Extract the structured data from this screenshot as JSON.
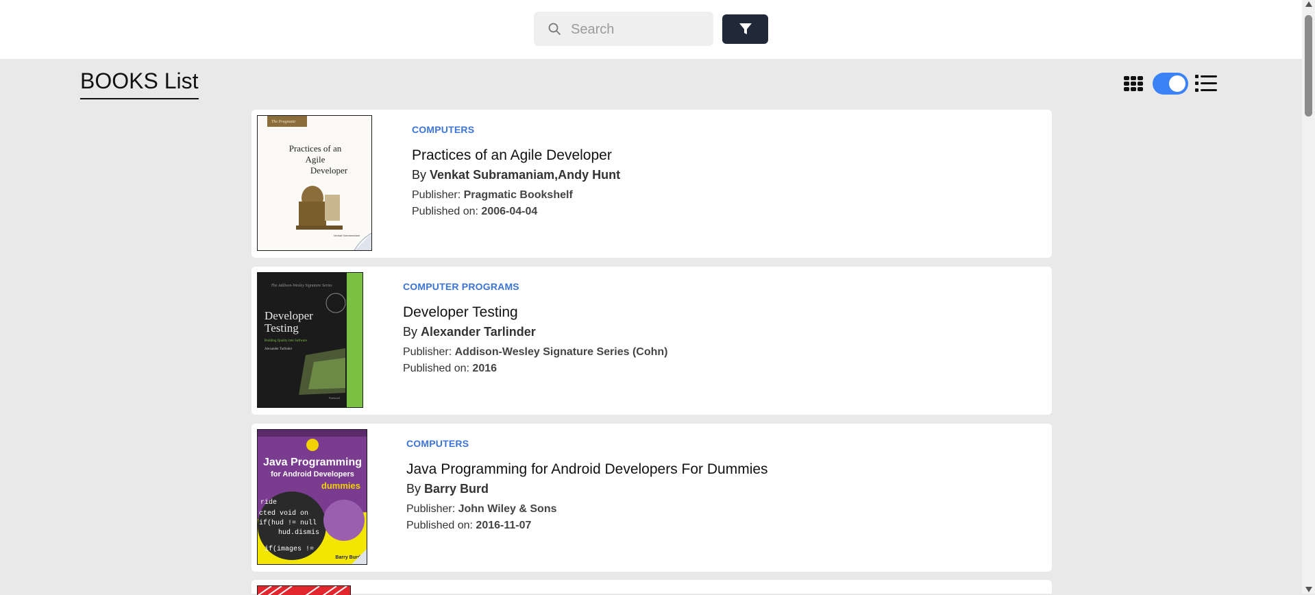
{
  "search": {
    "placeholder": "Search",
    "value": ""
  },
  "filter_button": {
    "icon": "funnel-icon"
  },
  "page": {
    "title": "BOOKS List"
  },
  "view_toggle": {
    "grid_icon": "grid-icon",
    "list_icon": "list-icon",
    "mode": "list",
    "accent": "#3b82f6"
  },
  "books": [
    {
      "category": "COMPUTERS",
      "title": "Practices of an Agile Developer",
      "by_label": "By",
      "authors": "Venkat Subramaniam,Andy Hunt",
      "publisher_label": "Publisher:",
      "publisher": "Pragmatic Bookshelf",
      "published_label": "Published on:",
      "published": "2006-04-04",
      "cover": {
        "line1": "Practices of an",
        "line2": "Agile",
        "line3": "Developer",
        "small": "Venkat Subramaniam"
      }
    },
    {
      "category": "COMPUTER PROGRAMS",
      "title": "Developer Testing",
      "by_label": "By",
      "authors": "Alexander Tarlinder",
      "publisher_label": "Publisher:",
      "publisher": "Addison-Wesley Signature Series (Cohn)",
      "published_label": "Published on:",
      "published": "2016",
      "cover": {
        "series": "The Addison-Wesley Signature Series",
        "line1": "Developer",
        "line2": "Testing",
        "sub": "Building Quality into Software",
        "author": "Alexander Tarlinder"
      }
    },
    {
      "category": "COMPUTERS",
      "title": "Java Programming for Android Developers For Dummies",
      "by_label": "By",
      "authors": "Barry Burd",
      "publisher_label": "Publisher:",
      "publisher": "John Wiley & Sons",
      "published_label": "Published on:",
      "published": "2016-11-07",
      "cover": {
        "line1": "Java Programming",
        "line2": "for Android Developers",
        "brand": "dummies",
        "author": "Barry Burd"
      }
    }
  ]
}
